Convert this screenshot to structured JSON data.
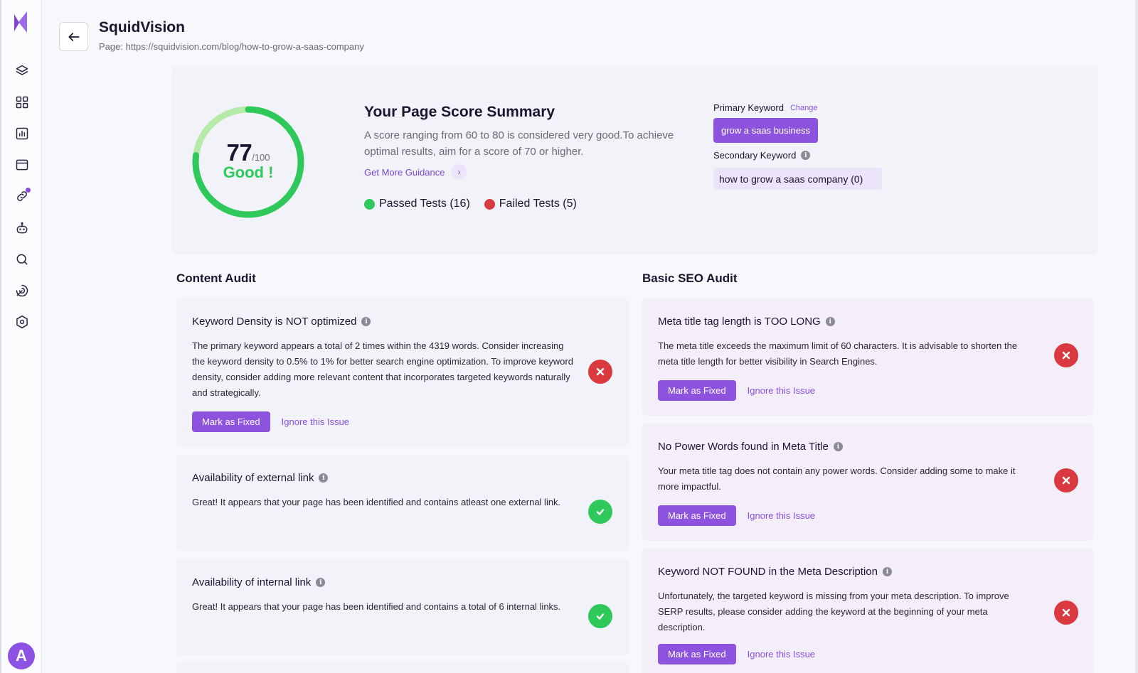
{
  "header": {
    "title": "SquidVision",
    "page_url": "Page: https://squidvision.com/blog/how-to-grow-a-saas-company"
  },
  "sidebar": {
    "icons": [
      "layers-icon",
      "grid-icon",
      "bar-chart-icon",
      "browser-icon",
      "link-icon",
      "robot-icon",
      "search-icon",
      "radar-icon",
      "settings-hex-icon"
    ],
    "avatar_letter": "A"
  },
  "summary": {
    "score": "77",
    "score_max": "/100",
    "grade": "Good !",
    "score_fraction": 0.77,
    "title": "Your Page Score Summary",
    "description": "A score ranging from 60 to 80 is considered very good.To achieve optimal results, aim for a score of 70 or higher.",
    "guidance_link": "Get More Guidance",
    "passed_label": "Passed Tests (16)",
    "failed_label": "Failed Tests (5)",
    "primary_keyword_label": "Primary Keyword",
    "change_label": "Change",
    "primary_keyword": "grow a saas business",
    "secondary_keyword_label": "Secondary Keyword",
    "secondary_keyword": "how to grow a saas company (0)"
  },
  "colors": {
    "accent": "#8d53de",
    "pass": "#2fc85a",
    "fail": "#d9393f",
    "gauge_light": "#b5eaa8"
  },
  "content_audit": {
    "title": "Content Audit",
    "items": [
      {
        "title": "Keyword Density is NOT optimized",
        "desc": "The primary keyword appears a total of 2 times within the 4319 words. Consider increasing the keyword density to 0.5% to 1% for better search engine optimization. To improve keyword density, consider adding more relevant content that incorporates targeted keywords naturally and strategically.",
        "status": "fail",
        "fix_label": "Mark as Fixed",
        "ignore_label": "Ignore this Issue"
      },
      {
        "title": "Availability of external link",
        "desc": "Great! It appears that your page has been identified and contains atleast one external link.",
        "status": "pass"
      },
      {
        "title": "Availability of internal link",
        "desc": "Great! It appears that your page has been identified and contains a total of 6 internal links.",
        "status": "pass"
      }
    ]
  },
  "seo_audit": {
    "title": "Basic SEO Audit",
    "items": [
      {
        "title": "Meta title tag length is TOO LONG",
        "desc": "The meta title exceeds the maximum limit of 60 characters. It is advisable to shorten the meta title length for better visibility in Search Engines.",
        "status": "fail",
        "fix_label": "Mark as Fixed",
        "ignore_label": "Ignore this Issue"
      },
      {
        "title": "No Power Words found in Meta Title",
        "desc": "Your meta title tag does not contain any power words. Consider adding some to make it more impactful.",
        "status": "fail",
        "fix_label": "Mark as Fixed",
        "ignore_label": "Ignore this Issue"
      },
      {
        "title": "Keyword NOT FOUND in the Meta Description",
        "desc": "Unfortunately, the targeted keyword is missing from your meta description. To improve SERP results, please consider adding the keyword at the beginning of your meta description.",
        "status": "fail",
        "fix_label": "Mark as Fixed",
        "ignore_label": "Ignore this Issue"
      }
    ]
  }
}
